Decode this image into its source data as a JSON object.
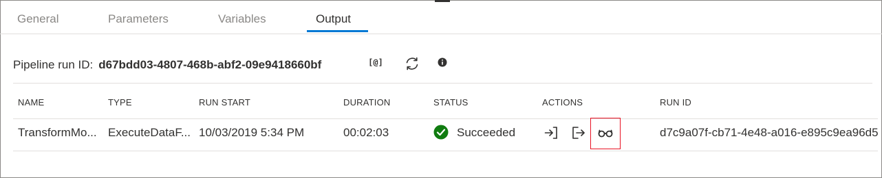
{
  "tabs": [
    {
      "label": "General",
      "active": false
    },
    {
      "label": "Parameters",
      "active": false
    },
    {
      "label": "Variables",
      "active": false
    },
    {
      "label": "Output",
      "active": true
    }
  ],
  "pipeline_run": {
    "label": "Pipeline run ID:",
    "id": "d67bdd03-4807-468b-abf2-09e9418660bf",
    "copy_icon_text": "[@]"
  },
  "table": {
    "columns": [
      "NAME",
      "TYPE",
      "RUN START",
      "DURATION",
      "STATUS",
      "ACTIONS",
      "RUN ID"
    ],
    "rows": [
      {
        "name": "TransformMo...",
        "type": "ExecuteDataF...",
        "run_start": "10/03/2019 5:34 PM",
        "duration": "00:02:03",
        "status": "Succeeded",
        "actions": [
          "input-icon",
          "output-icon",
          "glasses-icon"
        ],
        "run_id": "d7c9a07f-cb71-4e48-a016-e895c9ea96d5"
      }
    ]
  },
  "colors": {
    "accent": "#0078d4",
    "success": "#107c10",
    "highlight": "#e81123"
  }
}
